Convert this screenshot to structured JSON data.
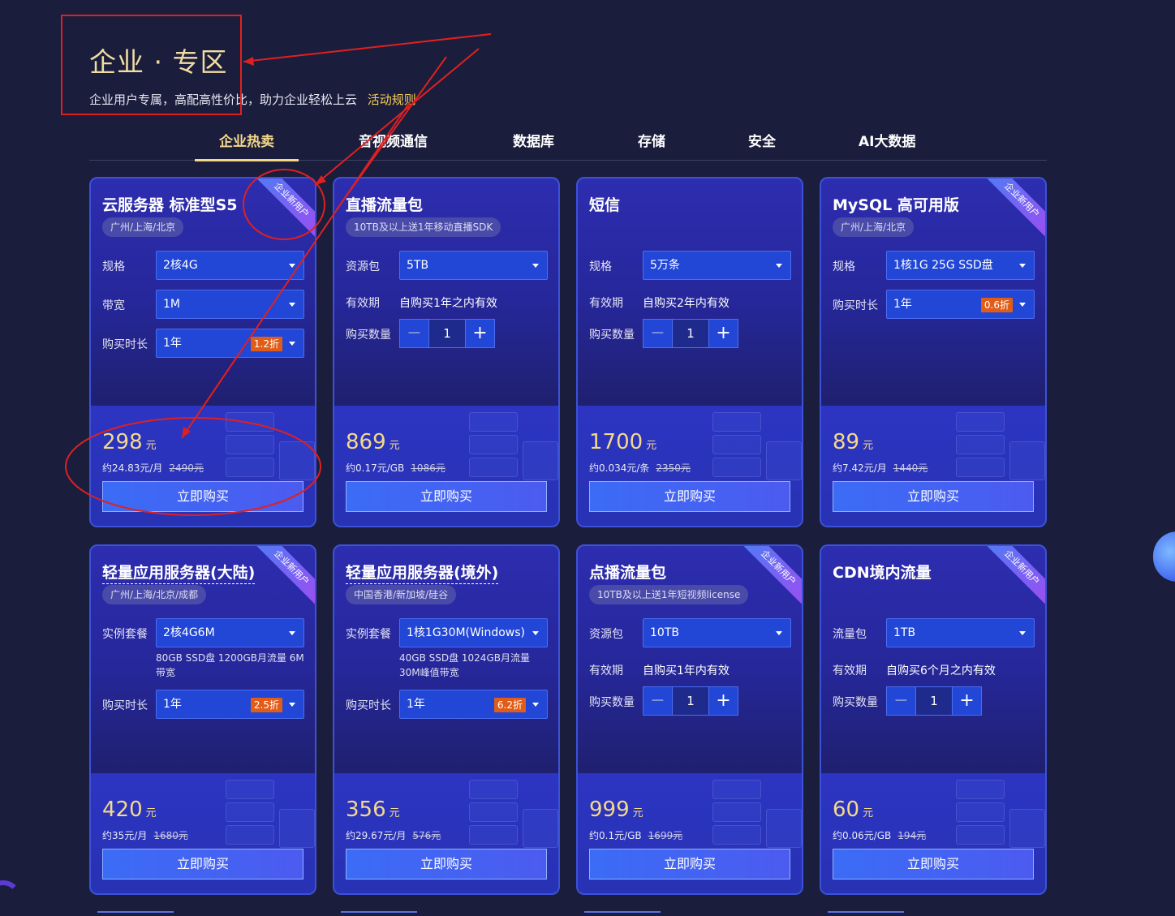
{
  "header": {
    "title": "企业 · 专区",
    "subtitle": "企业用户专属，高配高性价比，助力企业轻松上云",
    "rules_link": "活动规则"
  },
  "tabs": [
    "企业热卖",
    "音视频通信",
    "数据库",
    "存储",
    "安全",
    "AI大数据"
  ],
  "active_tab": "企业热卖",
  "ribbon_text": "企业新用户",
  "colors": {
    "accent_gold": "#f4d989",
    "discount_badge": "#e15d17",
    "background": "#1b1d3c"
  },
  "cards": [
    {
      "title": "云服务器 标准型S5",
      "badge": "广州/上海/北京",
      "ribbon": true,
      "rows": [
        {
          "label": "规格",
          "value": "2核4G",
          "type": "select"
        },
        {
          "label": "带宽",
          "value": "1M",
          "type": "select"
        },
        {
          "label": "购买时长",
          "value": "1年",
          "type": "select",
          "discount": "1.2折"
        }
      ],
      "price": "298",
      "price_unit": "元",
      "unit_price": "约24.83元/月",
      "orig_price": "2490元",
      "buy": "立即购买"
    },
    {
      "title": "直播流量包",
      "badge": "10TB及以上送1年移动直播SDK",
      "ribbon": false,
      "rows": [
        {
          "label": "资源包",
          "value": "5TB",
          "type": "select"
        },
        {
          "label": "有效期",
          "value": "自购买1年之内有效",
          "type": "text"
        },
        {
          "label": "购买数量",
          "value": "1",
          "type": "stepper"
        }
      ],
      "price": "869",
      "price_unit": "元",
      "unit_price": "约0.17元/GB",
      "orig_price": "1086元",
      "buy": "立即购买"
    },
    {
      "title": "短信",
      "badge": "",
      "ribbon": false,
      "rows": [
        {
          "label": "规格",
          "value": "5万条",
          "type": "select"
        },
        {
          "label": "有效期",
          "value": "自购买2年内有效",
          "type": "text"
        },
        {
          "label": "购买数量",
          "value": "1",
          "type": "stepper"
        }
      ],
      "price": "1700",
      "price_unit": "元",
      "unit_price": "约0.034元/条",
      "orig_price": "2350元",
      "buy": "立即购买"
    },
    {
      "title": "MySQL 高可用版",
      "badge": "广州/上海/北京",
      "ribbon": true,
      "rows": [
        {
          "label": "规格",
          "value": "1核1G 25G SSD盘",
          "type": "select"
        },
        {
          "label": "购买时长",
          "value": "1年",
          "type": "select",
          "discount": "0.6折"
        }
      ],
      "price": "89",
      "price_unit": "元",
      "unit_price": "约7.42元/月",
      "orig_price": "1440元",
      "buy": "立即购买"
    },
    {
      "title": "轻量应用服务器(大陆)",
      "badge": "广州/上海/北京/成都",
      "ribbon": true,
      "dashed": true,
      "rows": [
        {
          "label": "实例套餐",
          "value": "2核4G6M",
          "type": "select",
          "note": "80GB SSD盘 1200GB月流量 6M带宽"
        },
        {
          "label": "购买时长",
          "value": "1年",
          "type": "select",
          "discount": "2.5折"
        }
      ],
      "price": "420",
      "price_unit": "元",
      "unit_price": "约35元/月",
      "orig_price": "1680元",
      "buy": "立即购买"
    },
    {
      "title": "轻量应用服务器(境外)",
      "badge": "中国香港/新加坡/硅谷",
      "ribbon": false,
      "dashed": true,
      "rows": [
        {
          "label": "实例套餐",
          "value": "1核1G30M(Windows)",
          "type": "select",
          "note": "40GB SSD盘 1024GB月流量 30M峰值带宽"
        },
        {
          "label": "购买时长",
          "value": "1年",
          "type": "select",
          "discount": "6.2折"
        }
      ],
      "price": "356",
      "price_unit": "元",
      "unit_price": "约29.67元/月",
      "orig_price": "576元",
      "buy": "立即购买"
    },
    {
      "title": "点播流量包",
      "badge": "10TB及以上送1年短视频license",
      "ribbon": true,
      "rows": [
        {
          "label": "资源包",
          "value": "10TB",
          "type": "select"
        },
        {
          "label": "有效期",
          "value": "自购买1年内有效",
          "type": "text"
        },
        {
          "label": "购买数量",
          "value": "1",
          "type": "stepper"
        }
      ],
      "price": "999",
      "price_unit": "元",
      "unit_price": "约0.1元/GB",
      "orig_price": "1699元",
      "buy": "立即购买"
    },
    {
      "title": "CDN境内流量",
      "badge": "",
      "ribbon": true,
      "rows": [
        {
          "label": "流量包",
          "value": "1TB",
          "type": "select"
        },
        {
          "label": "有效期",
          "value": "自购买6个月之内有效",
          "type": "text"
        },
        {
          "label": "购买数量",
          "value": "1",
          "type": "stepper"
        }
      ],
      "price": "60",
      "price_unit": "元",
      "unit_price": "约0.06元/GB",
      "orig_price": "194元",
      "buy": "立即购买"
    }
  ]
}
